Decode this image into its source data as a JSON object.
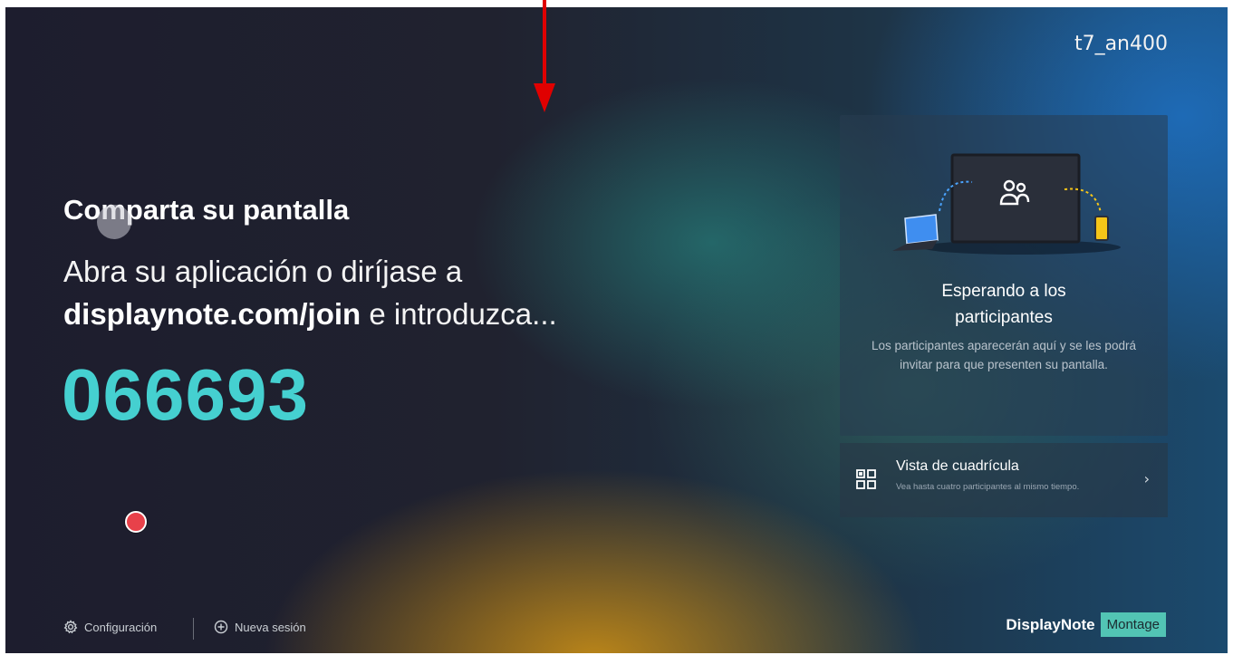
{
  "device": {
    "name": "t7_an400"
  },
  "share": {
    "title": "Comparta su pantalla",
    "instruction_line1": "Abra su aplicación o diríjase a",
    "join_url": "displaynote.com/join",
    "instruction_line2_suffix": " e introduzca...",
    "session_code": "066693"
  },
  "waiting_panel": {
    "icon": "people-icon",
    "title_line1": "Esperando a los",
    "title_line2": "participantes",
    "description": "Los participantes aparecerán aquí y se les podrá invitar para que presenten su pantalla."
  },
  "grid_view": {
    "icon": "grid-view-icon",
    "title": "Vista de cuadrícula",
    "description": "Vea hasta cuatro participantes al mismo tiempo.",
    "chevron": "›"
  },
  "footer": {
    "settings_label": "Configuración",
    "settings_icon": "gear-icon",
    "new_session_label": "Nueva sesión",
    "new_session_icon": "plus-circle-icon",
    "brand_name": "DisplayNote",
    "brand_product": "Montage"
  },
  "colors": {
    "accent_code": "#45d0d0",
    "brand_badge": "#52c4b4",
    "record": "#e8414a",
    "annotation_arrow": "#e00000"
  }
}
